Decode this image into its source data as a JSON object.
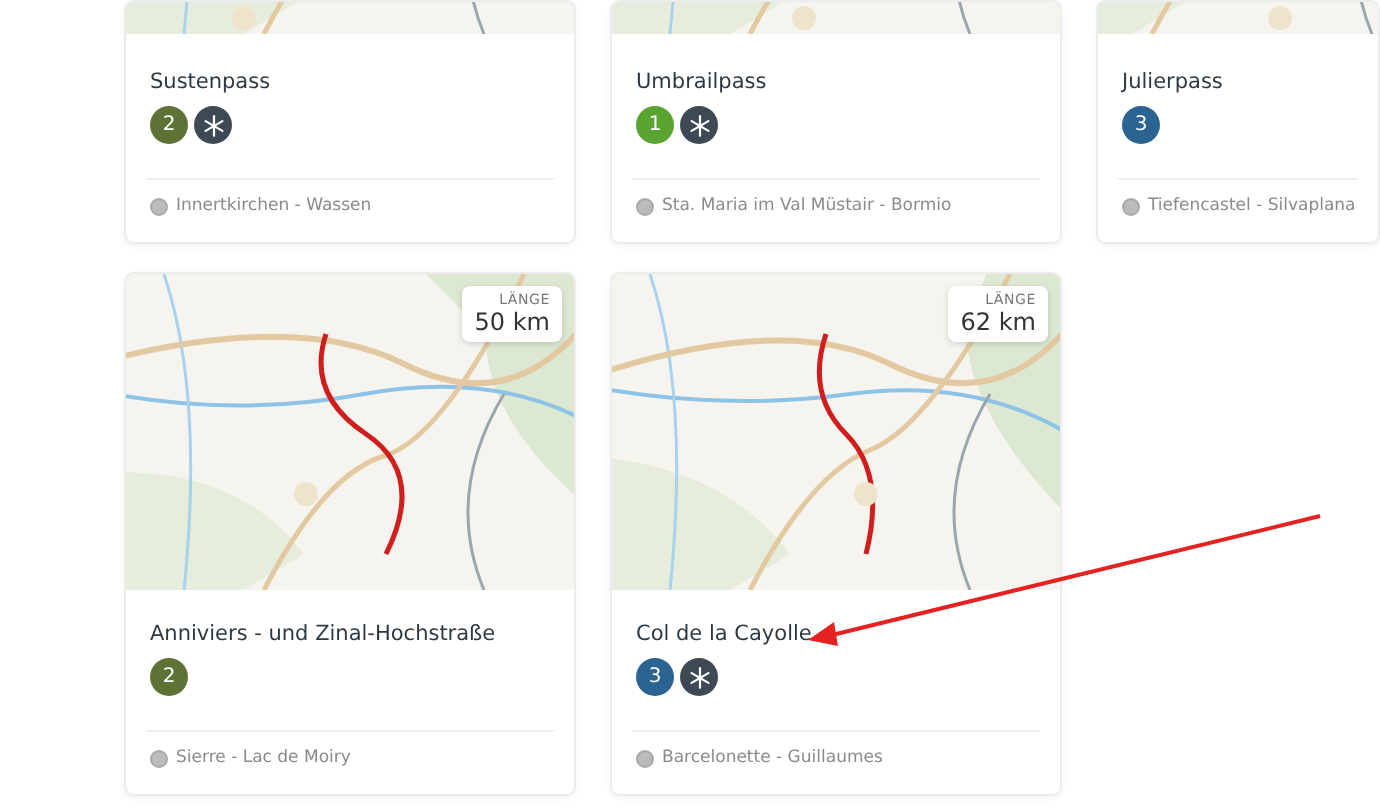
{
  "passes": [
    {
      "name": "Sustenpass",
      "badges": [
        {
          "label": "2",
          "color": "#5f7235"
        }
      ],
      "winter_closed": true,
      "route": "Innertkirchen - Wassen"
    },
    {
      "name": "Umbrailpass",
      "badges": [
        {
          "label": "1",
          "color": "#5aa531"
        }
      ],
      "winter_closed": true,
      "route": "Sta. Maria im Val Müstair - Bormio"
    },
    {
      "name": "Julierpass",
      "badges": [
        {
          "label": "3",
          "color": "#2c6491"
        }
      ],
      "winter_closed": false,
      "route": "Tiefencastel - Silvaplana"
    },
    {
      "name": "Anniviers - und Zinal-Hochstraße",
      "length": {
        "label": "LÄNGE",
        "value": "50 km"
      },
      "badges": [
        {
          "label": "2",
          "color": "#5f7235"
        }
      ],
      "winter_closed": false,
      "route": "Sierre - Lac de Moiry"
    },
    {
      "name": "Col de la Cayolle",
      "length": {
        "label": "LÄNGE",
        "value": "62 km"
      },
      "badges": [
        {
          "label": "3",
          "color": "#2c6491"
        }
      ],
      "winter_closed": true,
      "route": "Barcelonette - Guillaumes"
    }
  ]
}
